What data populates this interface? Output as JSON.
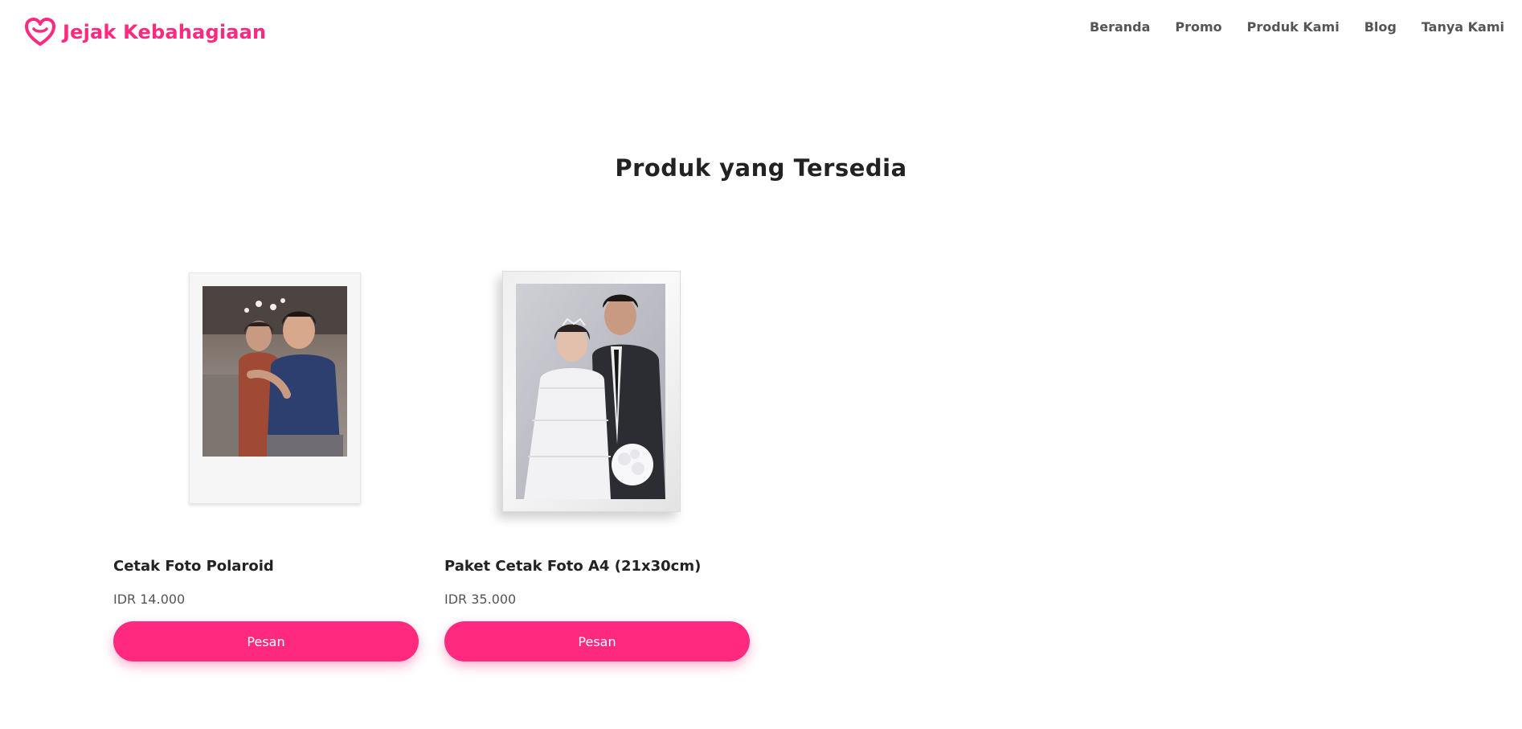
{
  "header": {
    "brand_name": "Jejak Kebahagiaan",
    "brand_icon": "heart-logo-icon",
    "brand_color": "#ff2a7f",
    "nav": [
      {
        "label": "Beranda"
      },
      {
        "label": "Promo"
      },
      {
        "label": "Produk Kami"
      },
      {
        "label": "Blog"
      },
      {
        "label": "Tanya Kami"
      }
    ]
  },
  "main": {
    "section_title": "Produk yang Tersedia",
    "products": [
      {
        "name": "Cetak Foto Polaroid",
        "price": "IDR 14.000",
        "button_label": "Pesan",
        "image": "polaroid-photo"
      },
      {
        "name": "Paket Cetak Foto A4 (21x30cm)",
        "price": "IDR 35.000",
        "button_label": "Pesan",
        "image": "framed-wedding-photo"
      }
    ]
  },
  "colors": {
    "accent": "#ff2a7f",
    "text_dark": "#222222",
    "text_muted": "#555555"
  }
}
